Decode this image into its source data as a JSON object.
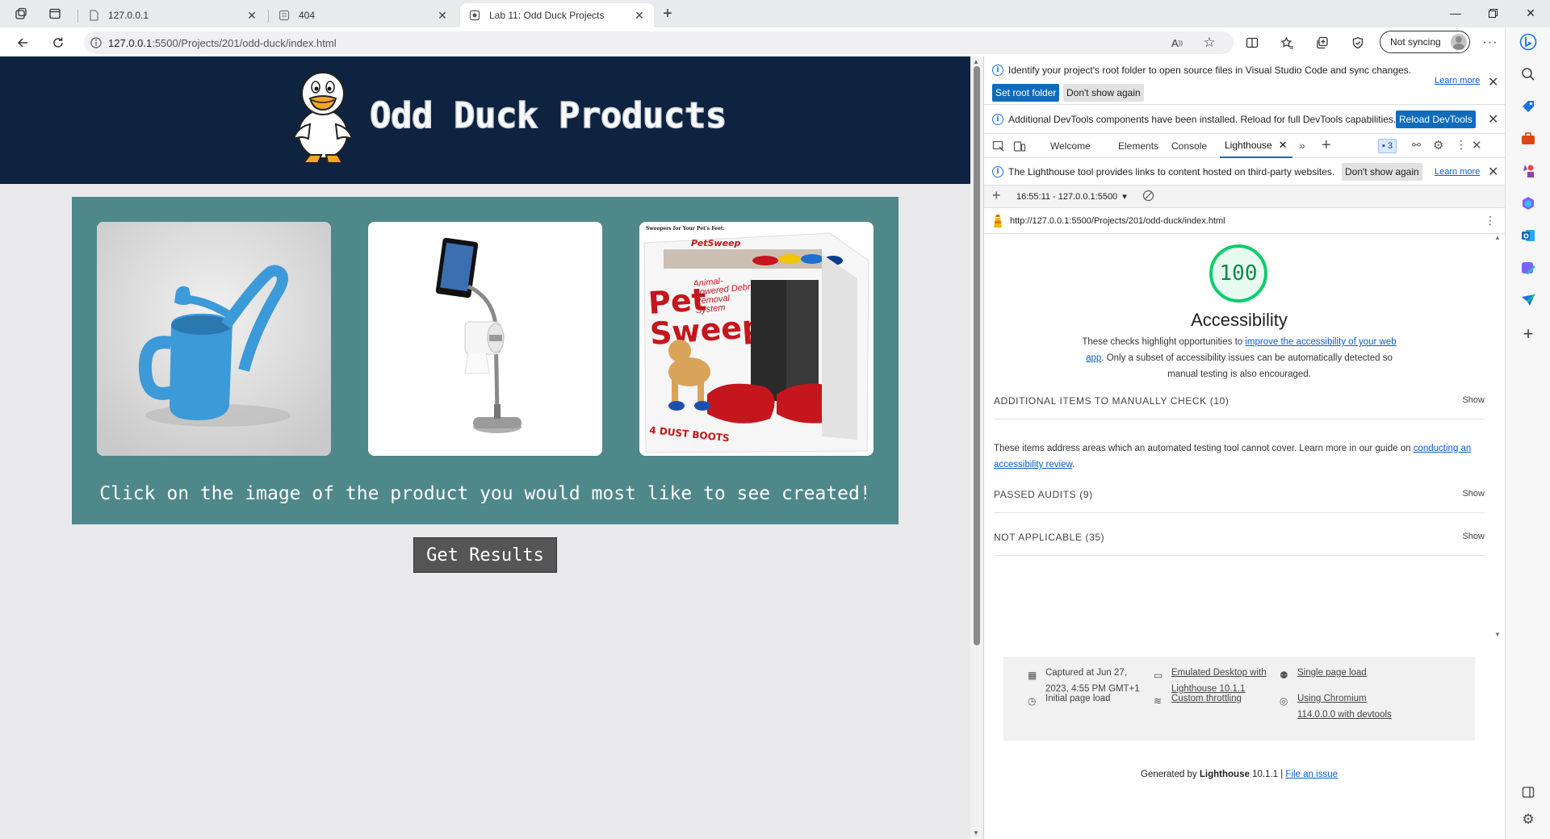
{
  "browser": {
    "tabs": [
      {
        "title": "127.0.0.1"
      },
      {
        "title": "404"
      },
      {
        "title": "Lab 11: Odd Duck Projects",
        "active": true
      }
    ],
    "address": {
      "host": "127.0.0.1",
      "path": ":5500/Projects/201/odd-duck/index.html"
    },
    "sync_label": "Not syncing"
  },
  "page": {
    "site_title": "Odd Duck Products",
    "products": [
      {
        "name": "watering-can",
        "color": "#3d9ad8"
      },
      {
        "name": "tablet-toilet-paper-stand",
        "color": "#9a9a9a"
      },
      {
        "name": "pet-sweep"
      }
    ],
    "pet_sweep_box": {
      "top_line": "Sweepers for Your Pet's Feet:",
      "brand": "PetSweep",
      "word1": "Pet",
      "word2": "Sweep",
      "tagline": "Animal-Powered Debris Removal System",
      "boots": "4 DUST BOOTS"
    },
    "prompt": "Click on the image of the product you would most like to see created!",
    "results_button": "Get Results",
    "colors": {
      "header": "#0e2340",
      "panel": "#4f888a",
      "background": "#e9e9ec"
    }
  },
  "devtools": {
    "infobar1": {
      "text": "Identify your project's root folder to open source files in Visual Studio Code and sync changes.",
      "learn_more": "Learn more",
      "btn_primary": "Set root folder",
      "btn_secondary": "Don't show again"
    },
    "infobar2": {
      "text": "Additional DevTools components have been installed. Reload for full DevTools capabilities.",
      "btn_primary": "Reload DevTools"
    },
    "tabs": [
      "Welcome",
      "Elements",
      "Console",
      "Lighthouse"
    ],
    "issues_count": "3",
    "infobar3": {
      "text": "The Lighthouse tool provides links to content hosted on third-party websites.",
      "btn_secondary": "Don't show again",
      "learn_more": "Learn more"
    },
    "report_selector": "16:55:11 - 127.0.0.1:5500",
    "report_url": "http://127.0.0.1:5500/Projects/201/odd-duck/index.html",
    "score": "100",
    "category": "Accessibility",
    "desc_before": "These checks highlight opportunities to ",
    "desc_link": "improve the accessibility of your web app",
    "desc_after": ". Only a subset of accessibility issues can be automatically detected so manual testing is also encouraged.",
    "groups": [
      {
        "label": "ADDITIONAL ITEMS TO MANUALLY CHECK",
        "count": "(10)",
        "action": "Show"
      },
      {
        "label": "PASSED AUDITS",
        "count": "(9)",
        "action": "Show"
      },
      {
        "label": "NOT APPLICABLE",
        "count": "(35)",
        "action": "Show"
      }
    ],
    "manual_before": "These items address areas which an automated testing tool cannot cover. Learn more in our guide on ",
    "manual_link": "conducting an accessibility review",
    "manual_after": ".",
    "meta": {
      "captured_l1": "Captured at Jun 27,",
      "captured_l2": "2023, 4:55 PM GMT+1",
      "initial": "Initial page load",
      "emulated_l1": "Emulated Desktop with",
      "emulated_l2": "Lighthouse 10.1.1",
      "throttling": "Custom throttling",
      "single": "Single page load",
      "chromium_l1": "Using Chromium",
      "chromium_l2": "114.0.0.0 with devtools"
    },
    "footer_before": "Generated by ",
    "footer_brand": "Lighthouse",
    "footer_version": " 10.1.1 | ",
    "footer_link": "File an issue",
    "score_color": "#0cce6b"
  }
}
